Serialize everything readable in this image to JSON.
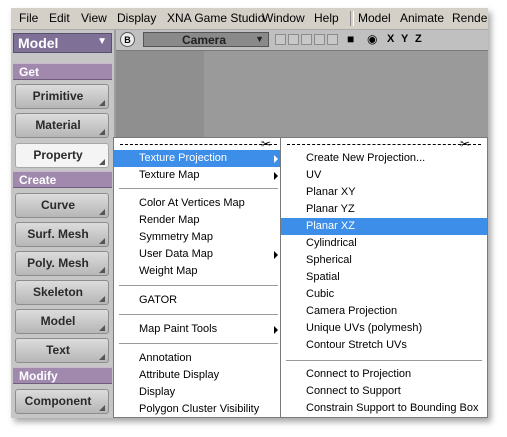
{
  "menubar": {
    "items": [
      "File",
      "Edit",
      "View",
      "Display",
      "XNA Game Studio",
      "Window",
      "Help",
      "Model",
      "Animate",
      "Render"
    ]
  },
  "left_panel": {
    "mode": "Model",
    "sections": {
      "get": "Get",
      "create": "Create",
      "modify": "Modify"
    },
    "buttons": [
      "Primitive",
      "Material",
      "Property",
      "Curve",
      "Surf. Mesh",
      "Poly. Mesh",
      "Skeleton",
      "Model",
      "Text",
      "Component"
    ],
    "active_button": "Property"
  },
  "viewport": {
    "b_button": "B",
    "camera": "Camera",
    "axes": [
      "X",
      "Y",
      "Z"
    ]
  },
  "property_menu": {
    "items": [
      "Texture Projection",
      "Texture Map",
      "Color At Vertices Map",
      "Render Map",
      "Symmetry Map",
      "User Data Map",
      "Weight Map",
      "GATOR",
      "Map Paint Tools",
      "Annotation",
      "Attribute Display",
      "Display",
      "Polygon Cluster Visibility"
    ],
    "highlighted": "Texture Projection"
  },
  "texture_projection_menu": {
    "items": [
      "Create New Projection...",
      "UV",
      "Planar XY",
      "Planar YZ",
      "Planar XZ",
      "Cylindrical",
      "Spherical",
      "Spatial",
      "Cubic",
      "Camera Projection",
      "Unique UVs (polymesh)",
      "Contour Stretch UVs",
      "Connect to Projection",
      "Connect to Support",
      "Constrain Support to Bounding Box"
    ],
    "highlighted": "Planar XZ"
  },
  "colors": {
    "menu_highlight": "#3d8ee8",
    "section_header": "#a089ad",
    "mode_select": "#7f7097"
  }
}
